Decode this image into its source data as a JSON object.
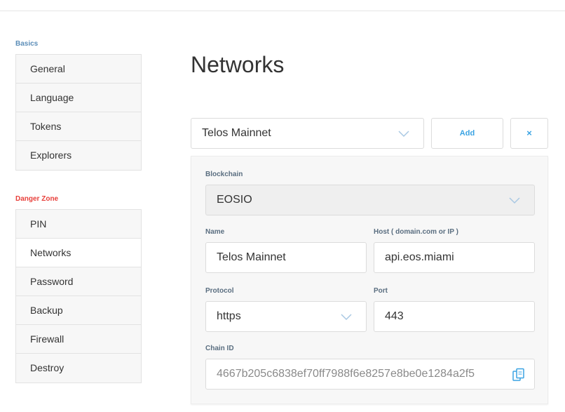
{
  "sidebar": {
    "basics_label": "Basics",
    "basics_items": [
      {
        "label": "General"
      },
      {
        "label": "Language"
      },
      {
        "label": "Tokens"
      },
      {
        "label": "Explorers"
      }
    ],
    "danger_label": "Danger Zone",
    "danger_items": [
      {
        "label": "PIN"
      },
      {
        "label": "Networks"
      },
      {
        "label": "Password"
      },
      {
        "label": "Backup"
      },
      {
        "label": "Firewall"
      },
      {
        "label": "Destroy"
      }
    ],
    "active_item": "Networks"
  },
  "main": {
    "title": "Networks",
    "network_select": {
      "value": "Telos Mainnet"
    },
    "add_label": "Add",
    "remove_label": "×",
    "form": {
      "blockchain": {
        "label": "Blockchain",
        "value": "EOSIO"
      },
      "name": {
        "label": "Name",
        "value": "Telos Mainnet"
      },
      "host": {
        "label": "Host ( domain.com or IP )",
        "value": "api.eos.miami"
      },
      "protocol": {
        "label": "Protocol",
        "value": "https"
      },
      "port": {
        "label": "Port",
        "value": "443"
      },
      "chain_id": {
        "label": "Chain ID",
        "value": "4667b205c6838ef70ff7988f6e8257e8be0e1284a2f5"
      }
    }
  },
  "colors": {
    "accent": "#3aa3e3",
    "danger": "#e8403b",
    "section_basics": "#5b8db8",
    "field_label": "#5a6e80"
  },
  "icons": {
    "chevron": "chevron-down-icon",
    "copy": "copy-icon"
  }
}
